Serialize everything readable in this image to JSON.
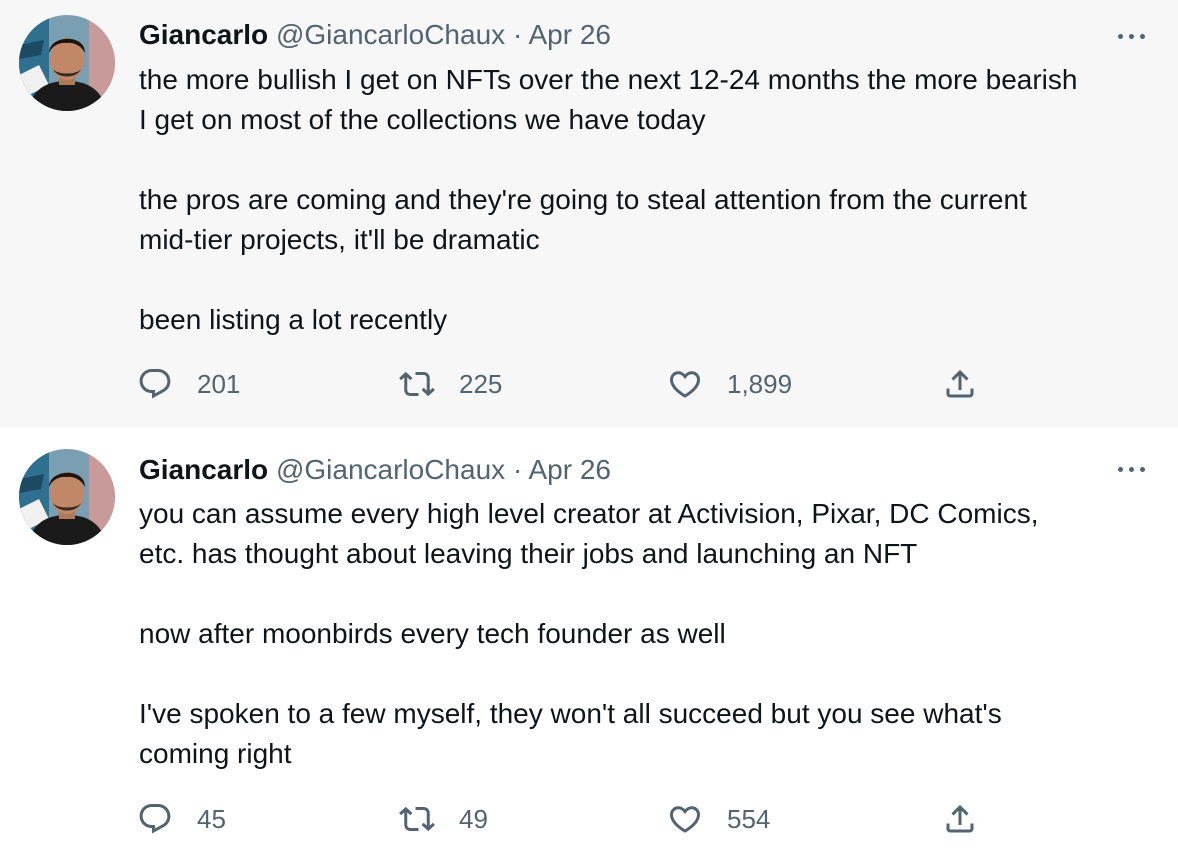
{
  "tweets": [
    {
      "name": "Giancarlo",
      "handle": "@GiancarloChaux",
      "separator": "·",
      "date": "Apr 26",
      "text": "the more bullish I get on NFTs over the next 12-24 months the more bearish\nI get on most of the collections we have today\n\nthe pros are coming and they're going to steal attention from the current\nmid-tier projects, it'll be dramatic\n\nbeen listing a lot recently",
      "replies": "201",
      "retweets": "225",
      "likes": "1,899"
    },
    {
      "name": "Giancarlo",
      "handle": "@GiancarloChaux",
      "separator": "·",
      "date": "Apr 26",
      "text": "you can assume every high level creator at Activision, Pixar, DC Comics,\netc. has thought about leaving their jobs and launching an NFT\n\nnow after moonbirds every tech founder as well\n\nI've spoken to a few myself, they won't all succeed but you see what's\ncoming right",
      "replies": "45",
      "retweets": "49",
      "likes": "554"
    }
  ],
  "icons": {
    "reply": "reply-icon",
    "retweet": "retweet-icon",
    "like": "heart-icon",
    "share": "share-icon",
    "more": "more-icon"
  },
  "colors": {
    "muted": "#536471",
    "text": "#0f1419",
    "thread_line": "#cfd9de",
    "highlight_bg": "#f7f7f7"
  }
}
